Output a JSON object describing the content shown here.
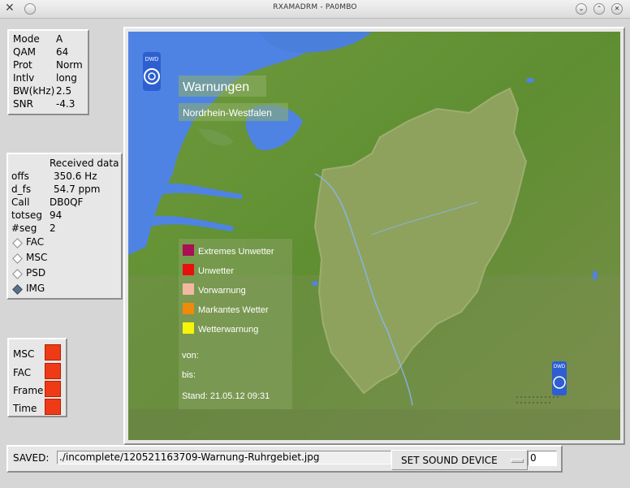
{
  "window": {
    "title": "RXAMADRM - PA0MBO"
  },
  "status": {
    "rows": [
      {
        "label": "Mode",
        "value": "A"
      },
      {
        "label": "QAM",
        "value": "64"
      },
      {
        "label": "Prot",
        "value": "Norm"
      },
      {
        "label": "Intlv",
        "value": "long"
      },
      {
        "label": "BW(kHz)",
        "value": "2.5"
      },
      {
        "label": "SNR",
        "value": "-4.3"
      }
    ]
  },
  "received": {
    "heading": "Received data",
    "rows": [
      {
        "label": "offs",
        "value": "350.6 Hz"
      },
      {
        "label": "d_fs",
        "value": "54.7 ppm"
      },
      {
        "label": "Call",
        "value": "DB0QF"
      },
      {
        "label": "totseg",
        "value": "94"
      },
      {
        "label": "#seg",
        "value": "2"
      }
    ],
    "options": [
      {
        "label": "FAC",
        "selected": false
      },
      {
        "label": "MSC",
        "selected": false
      },
      {
        "label": "PSD",
        "selected": false
      },
      {
        "label": "IMG",
        "selected": true
      }
    ]
  },
  "indicators": [
    {
      "label": "MSC",
      "color": "#ef3a17"
    },
    {
      "label": "FAC",
      "color": "#ef3a17"
    },
    {
      "label": "Frame",
      "color": "#ef3a17"
    },
    {
      "label": "Time",
      "color": "#ef3a17"
    }
  ],
  "image": {
    "logo": "DWD",
    "title": "Warnungen",
    "region": "Nordrhein-Westfalen",
    "legend": [
      {
        "label": "Extremes Unwetter",
        "color": "#a80f55"
      },
      {
        "label": "Unwetter",
        "color": "#e80f0f"
      },
      {
        "label": "Vorwarnung",
        "color": "#f4b8a0"
      },
      {
        "label": "Markantes Wetter",
        "color": "#f08a0a"
      },
      {
        "label": "Wetterwarnung",
        "color": "#f5f50a"
      }
    ],
    "from_label": "von:",
    "to_label": "bis:",
    "stand": "Stand: 21.05.12 09:31",
    "logo_small": "DWD"
  },
  "bottom": {
    "saved_label": "SAVED:",
    "saved_path": "./incomplete/120521163709-Warnung-Ruhrgebiet.jpg",
    "sound_button": "SET SOUND DEVICE",
    "device_value": "0"
  },
  "icons": {
    "close": "x-icon",
    "menu": "circle-icon",
    "minimize": "chevron-down-icon",
    "maximize": "chevron-up-icon",
    "closeRight": "close-icon"
  }
}
